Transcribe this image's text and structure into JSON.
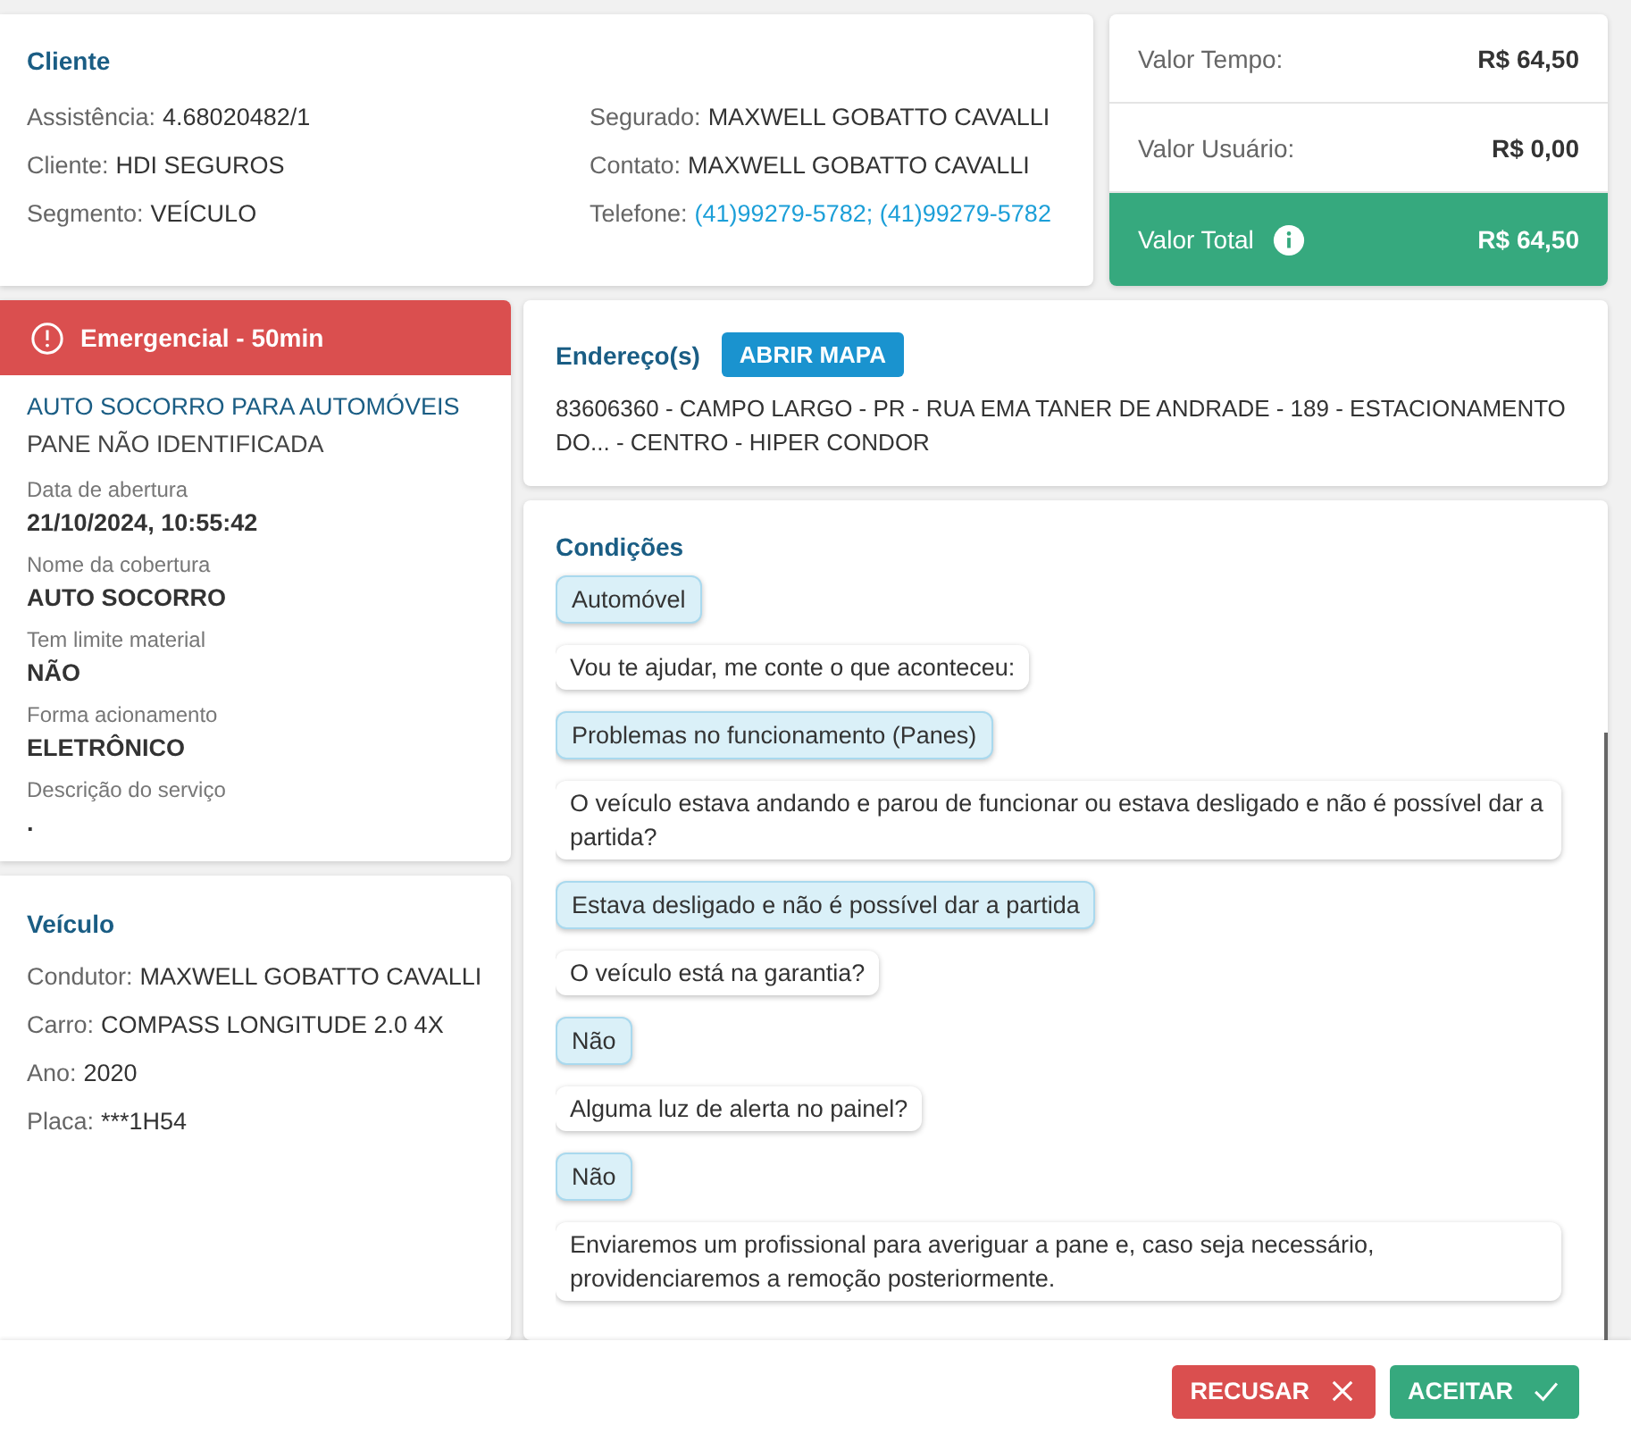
{
  "cliente": {
    "title": "Cliente",
    "fields": [
      {
        "label": "Assistência:",
        "value": "4.68020482/1",
        "kind": "text"
      },
      {
        "label": "Cliente:",
        "value": "HDI SEGUROS",
        "kind": "text"
      },
      {
        "label": "Segmento:",
        "value": "VEÍCULO",
        "kind": "text"
      },
      {
        "label": "Segurado:",
        "value": "MAXWELL GOBATTO CAVALLI",
        "kind": "text"
      },
      {
        "label": "Contato:",
        "value": "MAXWELL GOBATTO CAVALLI",
        "kind": "text"
      },
      {
        "label": "Telefone:",
        "value": "(41)99279-5782; (41)99279-5782",
        "kind": "link"
      }
    ]
  },
  "valores": [
    {
      "label": "Valor Tempo:",
      "value": "R$ 64,50",
      "kind": "plain"
    },
    {
      "label": "Valor Usuário:",
      "value": "R$ 0,00",
      "kind": "plain"
    },
    {
      "label": "Valor Total",
      "value": "R$ 64,50",
      "kind": "total"
    }
  ],
  "servico": {
    "alert": "Emergencial - 50min",
    "title": "AUTO SOCORRO PARA AUTOMÓVEIS",
    "subtitle": "PANE NÃO IDENTIFICADA",
    "fields": [
      {
        "label": "Data de abertura",
        "value": "21/10/2024, 10:55:42"
      },
      {
        "label": "Nome da cobertura",
        "value": "AUTO SOCORRO"
      },
      {
        "label": "Tem limite material",
        "value": "NÃO"
      },
      {
        "label": "Forma acionamento",
        "value": "ELETRÔNICO"
      },
      {
        "label": "Descrição do serviço",
        "value": "."
      }
    ]
  },
  "veiculo": {
    "title": "Veículo",
    "fields": [
      {
        "label": "Condutor:",
        "value": "MAXWELL GOBATTO CAVALLI"
      },
      {
        "label": "Carro:",
        "value": "COMPASS LONGITUDE 2.0 4X"
      },
      {
        "label": "Ano:",
        "value": "2020"
      },
      {
        "label": "Placa:",
        "value": "***1H54"
      }
    ]
  },
  "endereco": {
    "title": "Endereço(s)",
    "button": "ABRIR MAPA",
    "text": "83606360 - CAMPO LARGO - PR - RUA EMA TANER DE ANDRADE - 189 - ESTACIONAMENTO DO... - CENTRO - HIPER CONDOR"
  },
  "condicoes": {
    "title": "Condições",
    "messages": [
      {
        "kind": "answer",
        "text": "Automóvel"
      },
      {
        "kind": "question",
        "text": "Vou te ajudar, me conte o que aconteceu:"
      },
      {
        "kind": "answer",
        "text": "Problemas no funcionamento (Panes)"
      },
      {
        "kind": "question",
        "text": "O veículo estava andando e parou de funcionar ou estava desligado e não é possível dar a partida?"
      },
      {
        "kind": "answer",
        "text": "Estava desligado e não é possível dar a partida"
      },
      {
        "kind": "question",
        "text": "O veículo está na garantia?"
      },
      {
        "kind": "answer",
        "text": "Não"
      },
      {
        "kind": "question",
        "text": "Alguma luz de alerta no painel?"
      },
      {
        "kind": "answer",
        "text": "Não"
      },
      {
        "kind": "question",
        "text": "Enviaremos um profissional para averiguar a pane e, caso seja necessário, providenciaremos a remoção posteriormente."
      }
    ]
  },
  "actions": [
    {
      "label": "RECUSAR",
      "kind": "reject"
    },
    {
      "label": "ACEITAR",
      "kind": "accept"
    }
  ]
}
